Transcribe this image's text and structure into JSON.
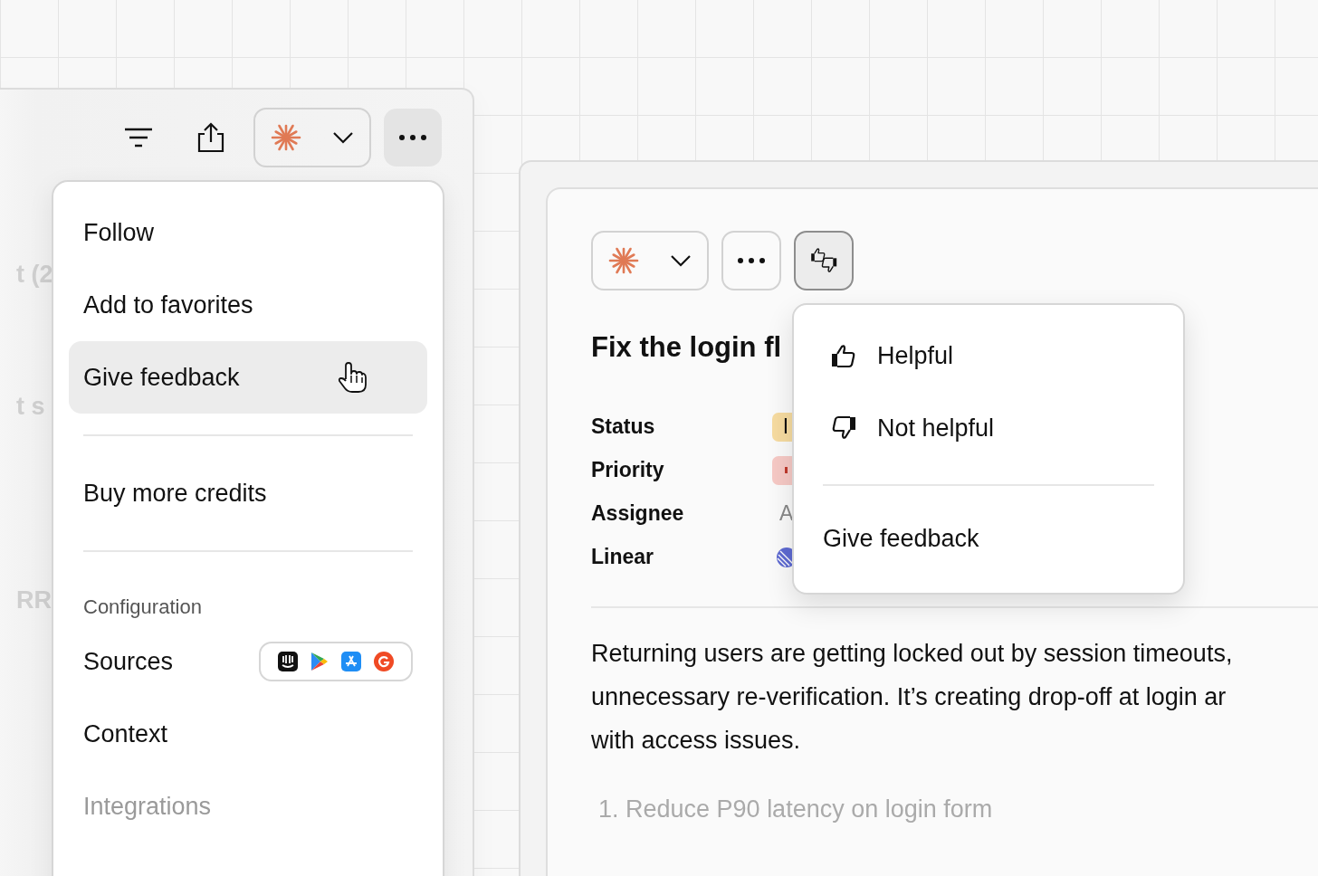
{
  "back_window": {
    "fragments": [
      "t (2",
      "t s",
      "RR"
    ]
  },
  "list_window": {
    "toolbar": [
      {
        "kind": "filter",
        "pressed": false
      },
      {
        "kind": "share",
        "pressed": false
      },
      {
        "kind": "model",
        "pressed": false
      },
      {
        "kind": "more",
        "pressed": true
      }
    ],
    "menu": [
      {
        "kind": "item",
        "label": "Follow",
        "selected": false,
        "faded": false
      },
      {
        "kind": "item",
        "label": "Add to favorites",
        "selected": false,
        "faded": false
      },
      {
        "kind": "item",
        "label": "Give feedback",
        "selected": true,
        "faded": false
      },
      {
        "kind": "divider"
      },
      {
        "kind": "item",
        "label": "Buy more credits",
        "selected": false,
        "faded": false
      },
      {
        "kind": "divider"
      },
      {
        "kind": "heading",
        "label": "Configuration"
      },
      {
        "kind": "sources",
        "label": "Sources"
      },
      {
        "kind": "item",
        "label": "Context",
        "selected": false,
        "faded": false
      },
      {
        "kind": "item",
        "label": "Integrations",
        "selected": false,
        "faded": true
      }
    ]
  },
  "detail_window": {
    "toolbar": [
      {
        "kind": "model",
        "pressed": false
      },
      {
        "kind": "more",
        "pressed": false
      },
      {
        "kind": "feedback",
        "pressed": true
      }
    ],
    "title": "Fix the login fl",
    "fields": [
      {
        "label": "Status",
        "kind": "badge",
        "value": "I",
        "color": "#f6dba0"
      },
      {
        "label": "Priority",
        "kind": "priority",
        "color": "#f6c9c5"
      },
      {
        "label": "Assignee",
        "kind": "text",
        "value": "A"
      },
      {
        "label": "Linear",
        "kind": "linear"
      }
    ],
    "paragraph_lines": [
      "Returning users are getting locked out by session timeouts,",
      "unnecessary re-verification. It’s creating drop-off at login ar",
      "with access issues."
    ],
    "list_items": [
      {
        "number": "1.",
        "text": "Reduce P90 latency on login form"
      }
    ]
  },
  "feedback_menu": [
    {
      "kind": "thumb-up",
      "label": "Helpful"
    },
    {
      "kind": "thumb-down",
      "label": "Not helpful"
    },
    {
      "kind": "divider"
    },
    {
      "kind": "plain",
      "label": "Give feedback"
    }
  ]
}
